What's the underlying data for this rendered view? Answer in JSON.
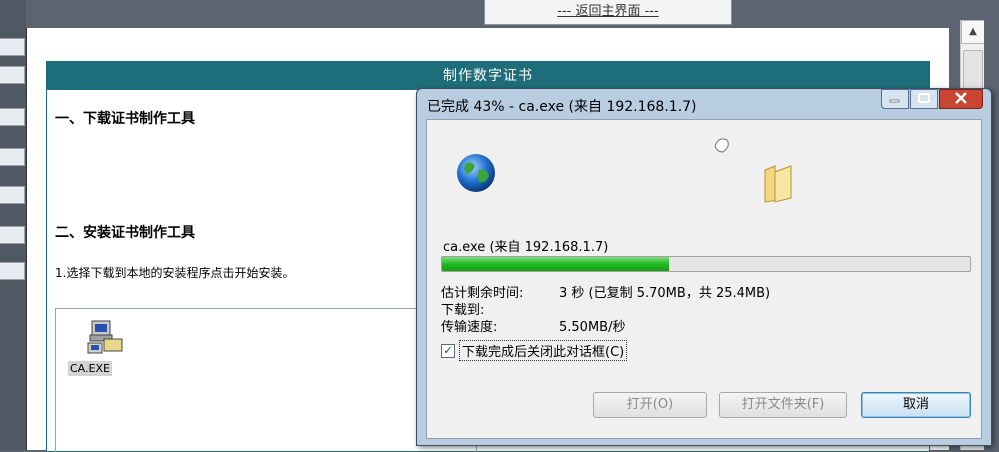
{
  "background": {
    "return_button": "--- 返回主界面 ---",
    "panel_title": "制作数字证书",
    "section1": "一、下载证书制作工具",
    "section2": "二、安装证书制作工具",
    "instruction": "1.选择下载到本地的安装程序点击开始安装。",
    "file_label": "CA.EXE"
  },
  "dialog": {
    "title": "已完成 43% - ca.exe (来自 192.168.1.7)",
    "file_source": "ca.exe (来自 192.168.1.7)",
    "progress": 0.43,
    "time_left_label": "估计剩余时间:",
    "time_left_value": "3 秒 (已复制 5.70MB，共 25.4MB)",
    "download_to_label": "下载到:",
    "speed_label": "传输速度:",
    "speed_value": "5.50MB/秒",
    "close_when_done_label": "下载完成后关闭此对话框(C)",
    "close_when_done_checked": true,
    "open_button": "打开(O)",
    "open_folder_button": "打开文件夹(F)",
    "cancel_button": "取消"
  },
  "colors": {
    "panel_header": "#1e6d7a",
    "progress": "#1fb41f"
  }
}
